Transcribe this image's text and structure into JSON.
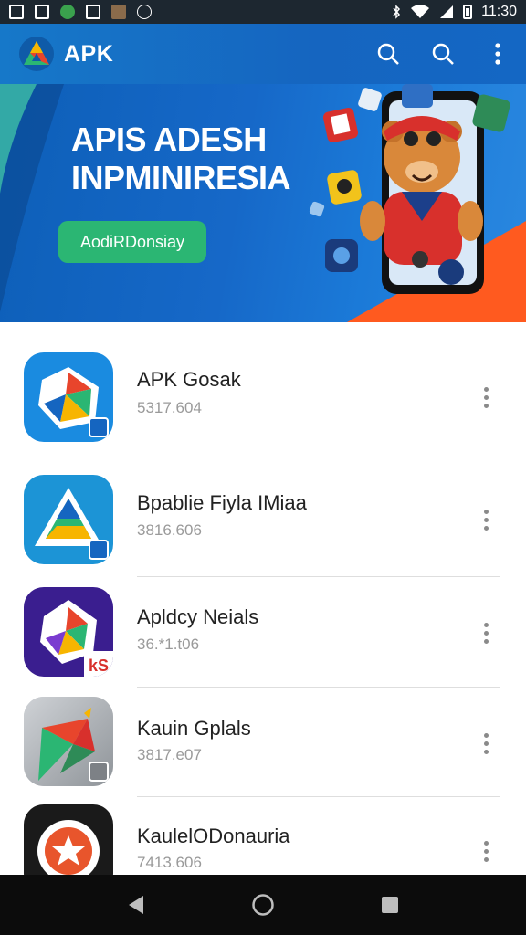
{
  "status_bar": {
    "time": "11:30",
    "icons": [
      "gallery-icon",
      "message-icon",
      "app-icon",
      "photo-icon",
      "sync-icon",
      "bluetooth-icon",
      "wifi-icon",
      "signal-icon",
      "battery-icon"
    ]
  },
  "app_bar": {
    "title": "APK",
    "logo": "apk-logo-icon",
    "actions": [
      "search-icon",
      "search-icon",
      "more-vert-icon"
    ]
  },
  "banner": {
    "title_line1": "APIS ADESH",
    "title_line2": "INPMINIRESIA",
    "button_label": "AodiRDonsiay",
    "accent_colors": [
      "#1668c8",
      "#2bb673",
      "#ff5a1f"
    ]
  },
  "apps": [
    {
      "name": "APK Gosak",
      "meta": "5317.604"
    },
    {
      "name": "Bpablie Fiyla IMiaa",
      "meta": "3816.606"
    },
    {
      "name": "Apldcy Neials",
      "meta": "36.*1.t06"
    },
    {
      "name": "Kauin Gplals",
      "meta": "3817.e07"
    },
    {
      "name": "KaulelODonauria",
      "meta": "7413.606"
    }
  ],
  "nav_bar": {
    "buttons": [
      "back-icon",
      "home-icon",
      "recents-icon"
    ]
  }
}
